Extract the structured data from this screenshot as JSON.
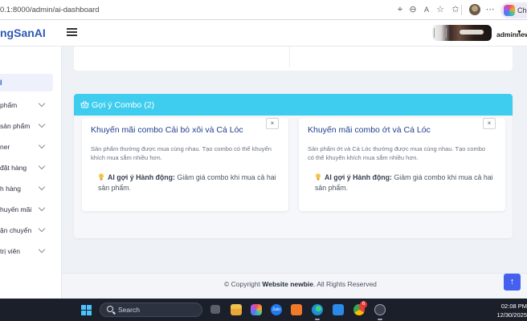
{
  "browser": {
    "url": "0.1:8000/admin/ai-dashboard",
    "chat_label": "Cha"
  },
  "header": {
    "brand": "ngSanAI",
    "username": "adminnew"
  },
  "sidebar": {
    "active_label": "I",
    "items": [
      {
        "label": "phẩm"
      },
      {
        "label": "sản phẩm"
      },
      {
        "label": "ner"
      },
      {
        "label": "đặt hàng"
      },
      {
        "label": "h hàng"
      },
      {
        "label": "huyến mãi"
      },
      {
        "label": "ận chuyển"
      },
      {
        "label": "trị viên"
      }
    ]
  },
  "combo_section": {
    "title": "Gợi ý Combo (2)",
    "cards": [
      {
        "title": "Khuyến mãi combo Cải bó xôi và Cá Lóc",
        "description": "Sản phẩm thường được mua cùng nhau. Tạo combo có thể khuyến khích mua sắm nhiều hơn.",
        "suggestion_label": "AI gợi ý Hành động:",
        "suggestion_text": "Giảm giá combo khi mua cả hai sản phẩm.",
        "close": "×"
      },
      {
        "title": "Khuyến mãi combo ớt và Cá Lóc",
        "description": "Sản phẩm ớt và Cá Lóc thường được mua cùng nhau. Tạo combo có thể khuyến khích mua sắm nhiều hơn.",
        "suggestion_label": "AI gợi ý Hành động:",
        "suggestion_text": "Giảm giá combo khi mua cả hai sản phẩm.",
        "close": "×"
      }
    ]
  },
  "footer": {
    "prefix": "© Copyright",
    "site": "Website newbie",
    "suffix": ". All Rights Reserved"
  },
  "scroll_top": "↑",
  "taskbar": {
    "search": "Search",
    "time": "02:08 PM",
    "date": "12/30/2025",
    "chrome_badge": "6"
  },
  "colors": {
    "brand": "#2d5ab7",
    "combo_header": "#3ecdef",
    "card_title": "#1f3f8f",
    "scroll_button": "#4361ee"
  }
}
